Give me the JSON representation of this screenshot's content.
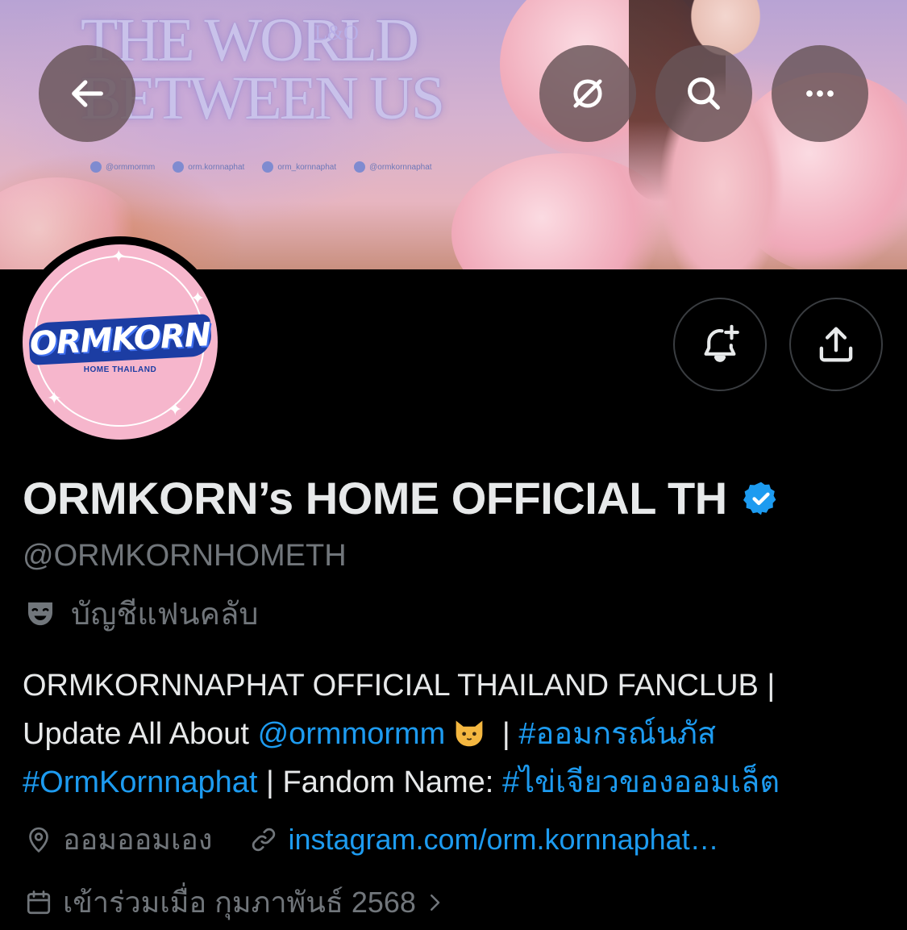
{
  "banner": {
    "title_line1": "THE WORLD",
    "title_line2": "BETWEEN US",
    "title_ornament": "L&O",
    "socials": [
      {
        "icon": "x-icon",
        "text": "@ormmormm"
      },
      {
        "icon": "instagram-icon",
        "text": "orm.kornnaphat"
      },
      {
        "icon": "threads-icon",
        "text": "orm_kornnaphat"
      },
      {
        "icon": "tiktok-icon",
        "text": "@ormkornnaphat"
      }
    ]
  },
  "nav": {
    "back_icon": "arrow-left-icon",
    "grok_icon": "grok-icon",
    "search_icon": "search-icon",
    "more_icon": "more-horizontal-icon"
  },
  "avatar": {
    "logo_text": "ORMKORN",
    "logo_subtext": "HOME THAILAND"
  },
  "actions": {
    "notify_icon": "bell-plus-icon",
    "share_icon": "share-icon"
  },
  "profile": {
    "display_name": "ORMKORN’s HOME OFFICIAL TH",
    "handle": "@ORMKORNHOMETH",
    "account_label": "บัญชีแฟนคลับ",
    "bio": {
      "line1": "ORMKORNNAPHAT OFFICIAL THAILAND FANCLUB |",
      "line2_prefix": "Update All About ",
      "line2_mention": "@ormmormm",
      "line2_sep": " | ",
      "line2_hashtag": "#ออมกรณ์นภัส",
      "line3_hashtag1": "#OrmKornnaphat",
      "line3_text": " | Fandom Name: ",
      "line3_hashtag2": "#ไข่เจียวของออมเล็ต"
    },
    "location": "ออมออมเอง",
    "website": "instagram.com/orm.kornnaphat…",
    "joined": "เข้าร่วมเมื่อ กุมภาพันธ์ 2568"
  },
  "colors": {
    "background": "#000000",
    "text_primary": "#e7e9ea",
    "text_secondary": "#71767b",
    "link": "#1d9bf0",
    "verified": "#1d9bf0"
  }
}
